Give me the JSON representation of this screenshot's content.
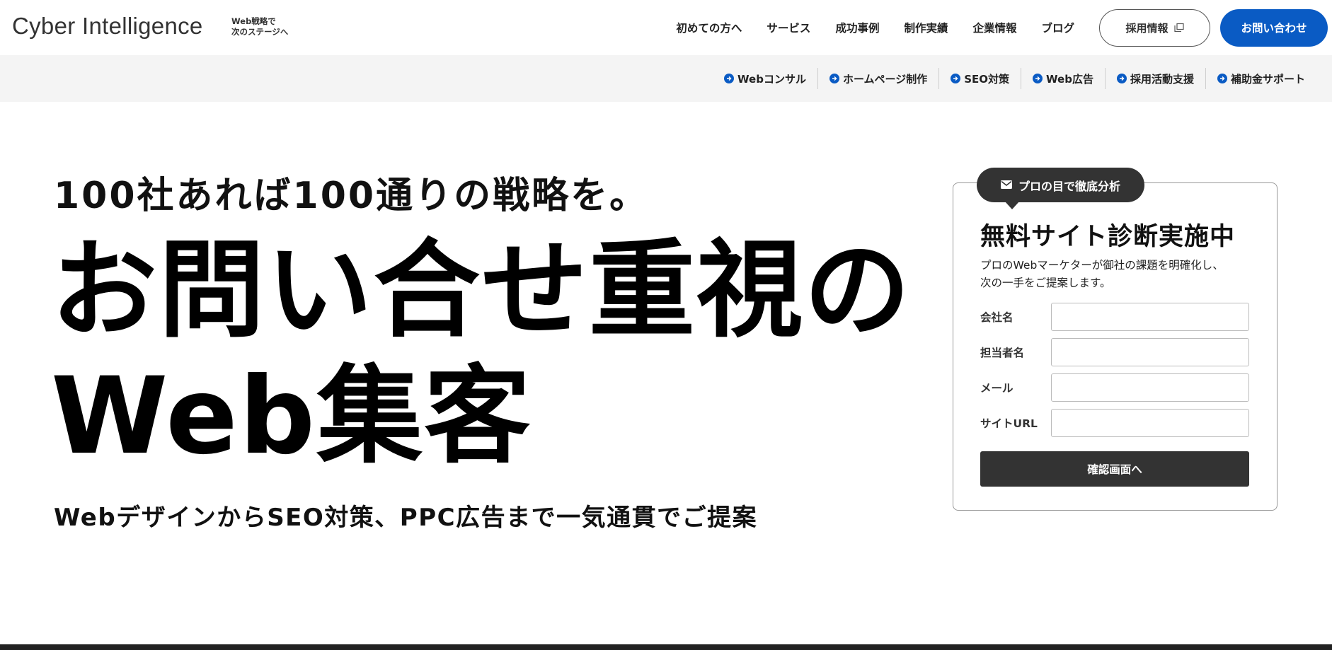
{
  "header": {
    "logo": "Cyber Intelligence",
    "tagline_line1": "Web戦略で",
    "tagline_line2": "次のステージへ",
    "nav": [
      "初めての方へ",
      "サービス",
      "成功事例",
      "制作実績",
      "企業情報",
      "ブログ"
    ],
    "recruit_label": "採用情報",
    "contact_label": "お問い合わせ"
  },
  "subnav": {
    "items": [
      "Webコンサル",
      "ホームページ制作",
      "SEO対策",
      "Web広告",
      "採用活動支援",
      "補助金サポート"
    ]
  },
  "hero": {
    "subtitle": "100社あれば100通りの戦略を。",
    "title_line1": "お問い合せ重視の",
    "title_line2": "Web集客",
    "description": "WebデザインからSEO対策、PPC広告まで一気通貫でご提案"
  },
  "form": {
    "badge": "プロの目で徹底分析",
    "title": "無料サイト診断実施中",
    "desc_line1": "プロのWebマーケターが御社の課題を明確化し、",
    "desc_line2": "次の一手をご提案します。",
    "fields": [
      {
        "label": "会社名",
        "value": ""
      },
      {
        "label": "担当者名",
        "value": ""
      },
      {
        "label": "メール",
        "value": ""
      },
      {
        "label": "サイトURL",
        "value": ""
      }
    ],
    "submit_label": "確認画面へ"
  },
  "colors": {
    "accent": "#0a5bc4",
    "dark": "#333333",
    "subnav_bg": "#f4f4f4"
  }
}
